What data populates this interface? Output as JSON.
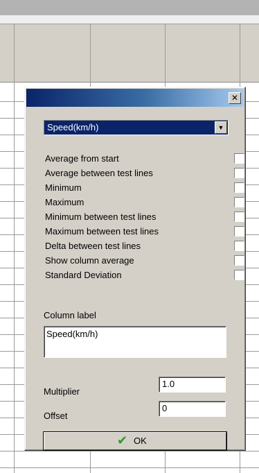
{
  "dialog": {
    "close_glyph": "✕",
    "column_select": {
      "value": "Speed(km/h)",
      "arrow_glyph": "▼"
    },
    "options": [
      {
        "label": "Average from start",
        "checked": false
      },
      {
        "label": "Average between test lines",
        "checked": false
      },
      {
        "label": "Minimum",
        "checked": false
      },
      {
        "label": "Maximum",
        "checked": false
      },
      {
        "label": "Minimum between test lines",
        "checked": false
      },
      {
        "label": "Maximum between test lines",
        "checked": false
      },
      {
        "label": "Delta between test lines",
        "checked": false
      },
      {
        "label": "Show column average",
        "checked": false
      },
      {
        "label": "Standard Deviation",
        "checked": false
      }
    ],
    "column_label": {
      "label": "Column label",
      "value": "Speed(km/h)"
    },
    "multiplier": {
      "label": "Multiplier",
      "value": "1.0"
    },
    "offset": {
      "label": "Offset",
      "value": "0"
    },
    "ok_button": {
      "icon": "checkmark-icon",
      "label": "OK"
    }
  },
  "colors": {
    "dialog_bg": "#d4d0c8",
    "title_gradient_start": "#0a246a",
    "title_gradient_end": "#a6caf0",
    "selection_bg": "#0a246a",
    "check_green": "#2a9d20"
  }
}
